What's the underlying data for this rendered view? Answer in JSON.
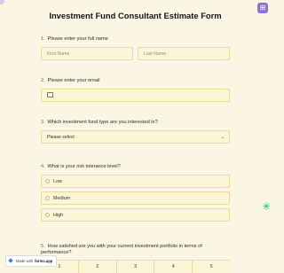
{
  "form": {
    "title": "Investment Fund Consultant Estimate Form"
  },
  "questions": {
    "q1": {
      "number": "1.",
      "label": "Please enter your full name"
    },
    "q2": {
      "number": "2.",
      "label": "Please enter your email"
    },
    "q3": {
      "number": "3.",
      "label": "Which investment fund type are you interested in?"
    },
    "q4": {
      "number": "4.",
      "label": "What is your risk tolerance level?"
    },
    "q5": {
      "number": "5.",
      "label": "How satisfied are you with your current investment portfolio in terms of performance?"
    }
  },
  "fields": {
    "first_name_placeholder": "First Name",
    "last_name_placeholder": "Last Name",
    "fund_type_value": "Please select"
  },
  "risk_options": [
    "Low",
    "Medium",
    "High"
  ],
  "satisfaction_scale": [
    "1",
    "2",
    "3",
    "4",
    "5"
  ],
  "badge": {
    "prefix": "Made with",
    "brand": "forms.app"
  },
  "icons": {
    "corner_button": "app-icon",
    "sparkle": "sparkle-icon",
    "email": "mail-icon",
    "dropdown": "chevron-down-icon"
  },
  "colors": {
    "background": "#fbf6e3",
    "field_bg": "#fdf6d6",
    "field_border": "#e7d99a",
    "accent": "#8a6fd6",
    "sparkle": "#22c55e"
  }
}
